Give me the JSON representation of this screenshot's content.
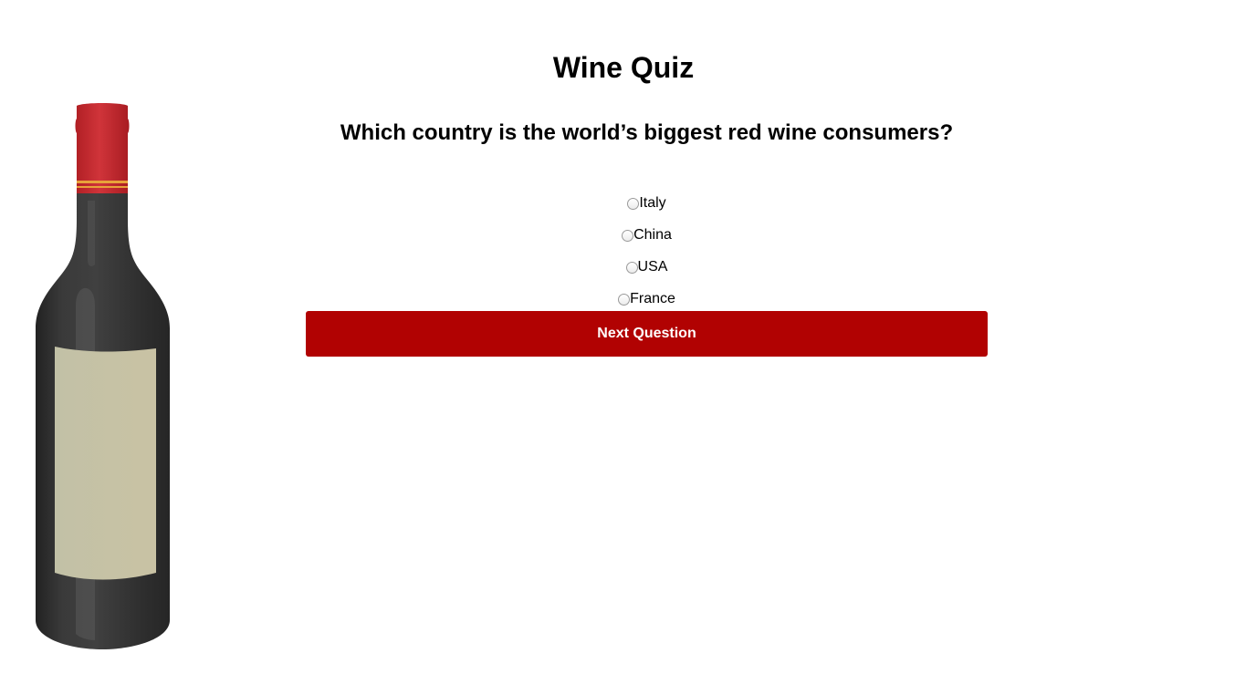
{
  "quiz": {
    "title": "Wine Quiz",
    "question": "Which country is the world’s biggest red wine consumers?",
    "options": [
      {
        "label": "Italy",
        "selected": false
      },
      {
        "label": "China",
        "selected": false
      },
      {
        "label": "USA",
        "selected": false
      },
      {
        "label": "France",
        "selected": false
      }
    ],
    "next_label": "Next Question"
  },
  "decor": {
    "illustration_icon": "wine-bottle-icon"
  },
  "colors": {
    "button_background": "#b10202",
    "button_text": "#ffffff",
    "bottle_glass": "#333333",
    "bottle_capsule": "#c4282c",
    "bottle_label": "#c6c2a6"
  }
}
